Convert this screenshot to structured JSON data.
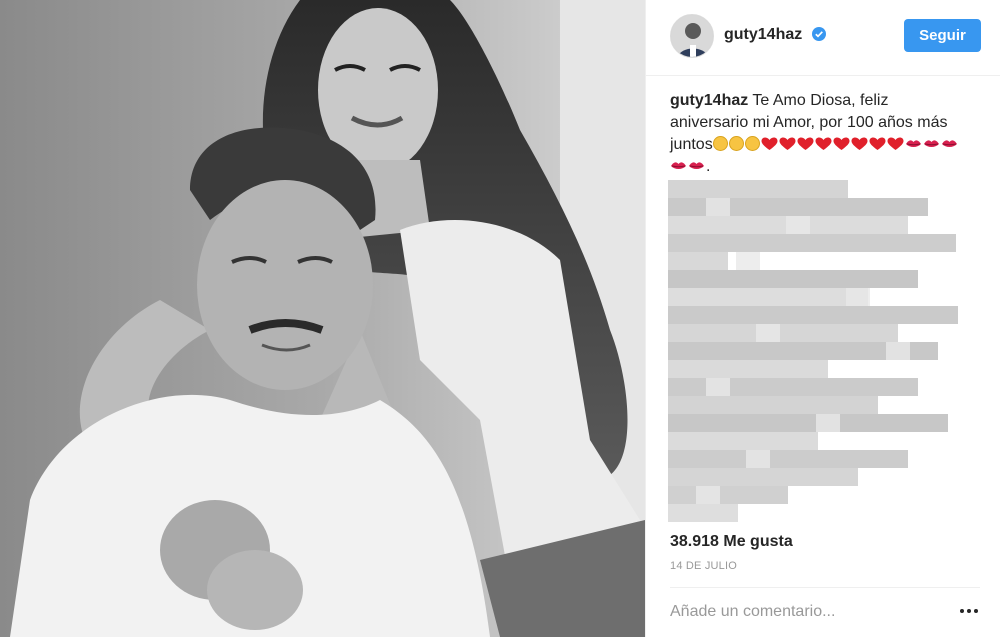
{
  "post": {
    "username": "guty14haz",
    "verified": true,
    "follow_label": "Seguir",
    "caption": {
      "username": "guty14haz",
      "text": "Te Amo Diosa, feliz aniversario mi Amor, por 100 años más juntos",
      "tail": "."
    },
    "caption_emoji": [
      "relieved-face",
      "relieved-face",
      "relieved-face",
      "red-heart",
      "red-heart",
      "red-heart",
      "red-heart",
      "red-heart",
      "red-heart",
      "red-heart",
      "red-heart",
      "kiss-mark",
      "kiss-mark",
      "kiss-mark",
      "kiss-mark",
      "kiss-mark"
    ],
    "likes": "38.918 Me gusta",
    "date": "14 DE JULIO",
    "comment_placeholder": "Añade un comentario..."
  },
  "colors": {
    "follow_button": "#3897f0",
    "verified_badge": "#3897f0",
    "text": "#262626",
    "muted": "#999999",
    "border": "#efefef"
  },
  "icons": {
    "verified": "verified-badge-icon",
    "more": "more-options-icon"
  }
}
